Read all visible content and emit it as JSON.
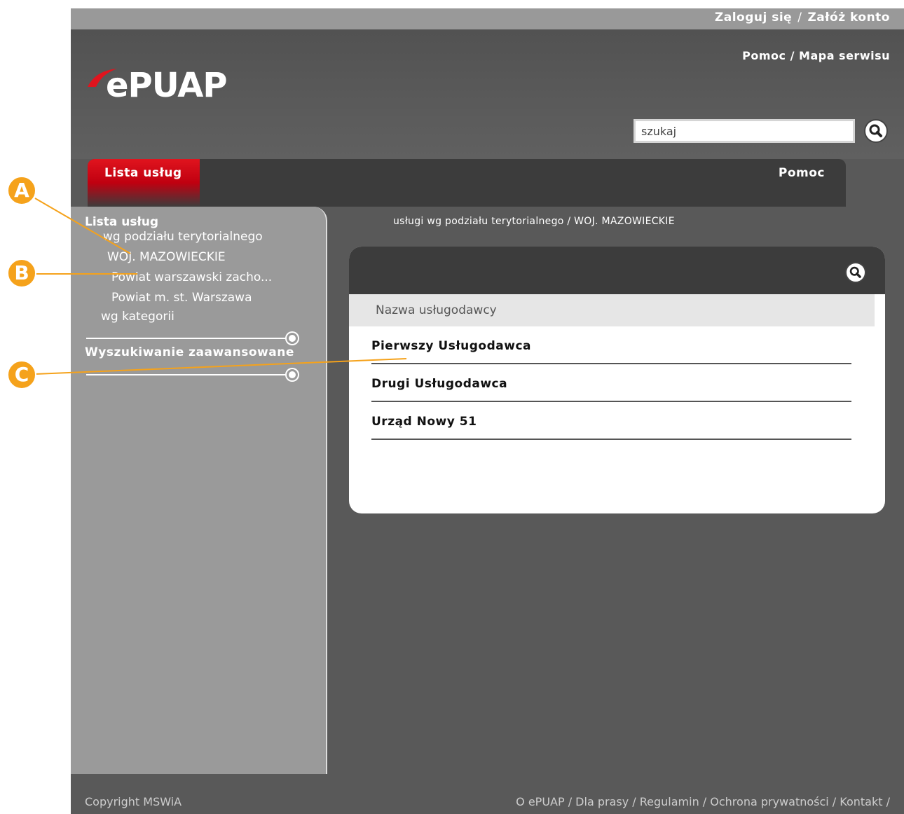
{
  "topbar": {
    "login": "Zaloguj się",
    "separator": "/",
    "register": "Załóż konto"
  },
  "header": {
    "help": "Pomoc",
    "separator": "/",
    "sitemap": "Mapa serwisu",
    "logo_text": "ePUAP"
  },
  "search": {
    "value": "szukaj"
  },
  "nav": {
    "active_tab": "Lista usług",
    "help_tab": "Pomoc"
  },
  "sidebar": {
    "title": "Lista usług",
    "items": [
      {
        "label": "wg podziału terytorialnego"
      },
      {
        "label": "WOJ. MAZOWIECKIE"
      },
      {
        "label": "Powiat warszawski zacho..."
      },
      {
        "label": "Powiat m. st. Warszawa"
      },
      {
        "label": "wg kategorii"
      }
    ],
    "advanced": "Wyszukiwanie zaawansowane"
  },
  "breadcrumb": "usługi wg podziału terytorialnego / WOJ. MAZOWIECKIE",
  "results": {
    "column_header": "Nazwa usługodawcy",
    "rows": [
      {
        "name": "Pierwszy Usługodawca"
      },
      {
        "name": "Drugi Usługodawca"
      },
      {
        "name": "Urząd Nowy 51"
      }
    ]
  },
  "footer": {
    "copyright": "Copyright MSWiA",
    "links": "O ePUAP / Dla prasy / Regulamin / Ochrona prywatności / Kontakt /"
  },
  "callouts": {
    "a": "A",
    "b": "B",
    "c": "C"
  },
  "colors": {
    "accent": "#e0141e",
    "callout": "#f5a21b",
    "dark": "#3c3c3c"
  }
}
